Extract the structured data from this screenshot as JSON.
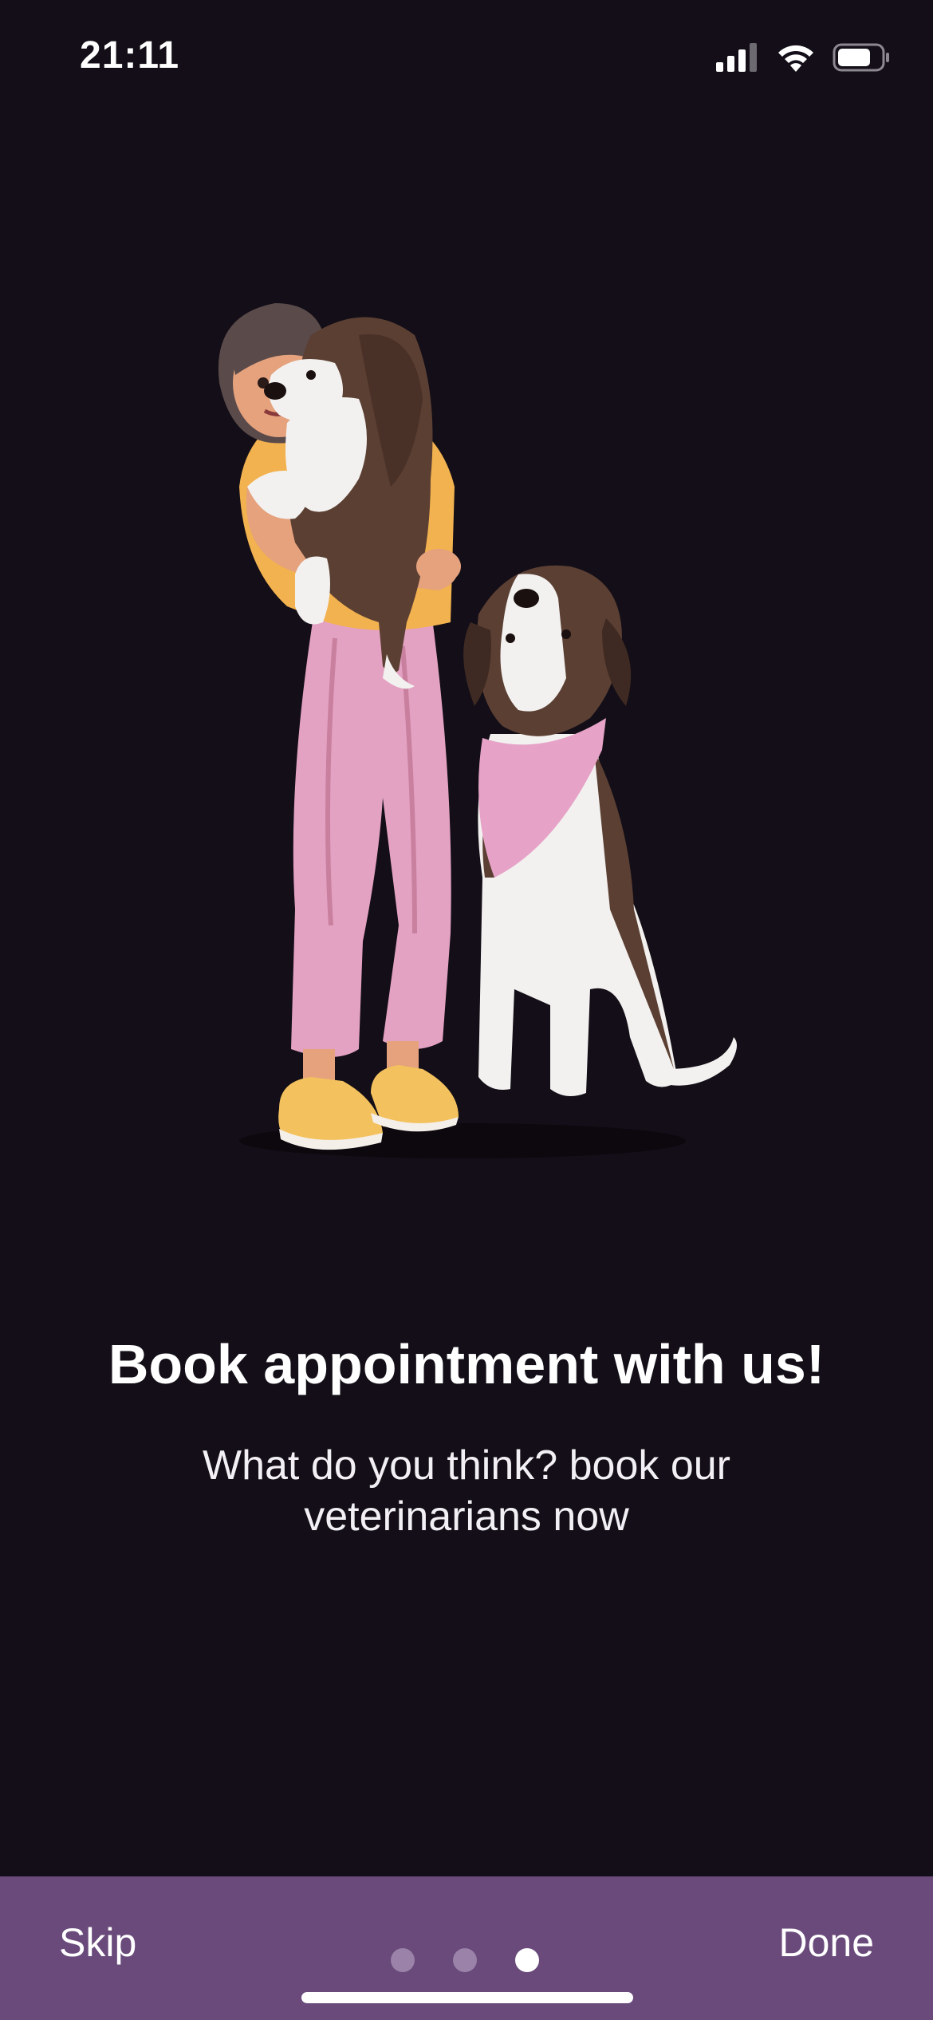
{
  "status_bar": {
    "time": "21:11",
    "icons": [
      "cellular-signal-icon",
      "wifi-icon",
      "battery-icon"
    ]
  },
  "illustration": {
    "subject": "woman-holding-dog-and-sitting-dog",
    "colors": {
      "shirt": "#f2b24f",
      "pants": "#e4a2c2",
      "shoes": "#f3c15e",
      "dog_brown": "#5b3f33",
      "dog_white": "#f3f1ef",
      "bandana": "#e6a3c7",
      "skin": "#e5a27d",
      "hair": "#5a4a4a"
    }
  },
  "content": {
    "title": "Book appointment with us!",
    "subtitle": "What do you think? book our veterinarians now"
  },
  "navigation": {
    "skip_label": "Skip",
    "done_label": "Done",
    "page_count": 3,
    "active_page": 3
  },
  "colors": {
    "background": "#130e17",
    "bottom_bar": "#694a7b",
    "dot_inactive": "#9a82a8",
    "dot_active": "#ffffff"
  }
}
